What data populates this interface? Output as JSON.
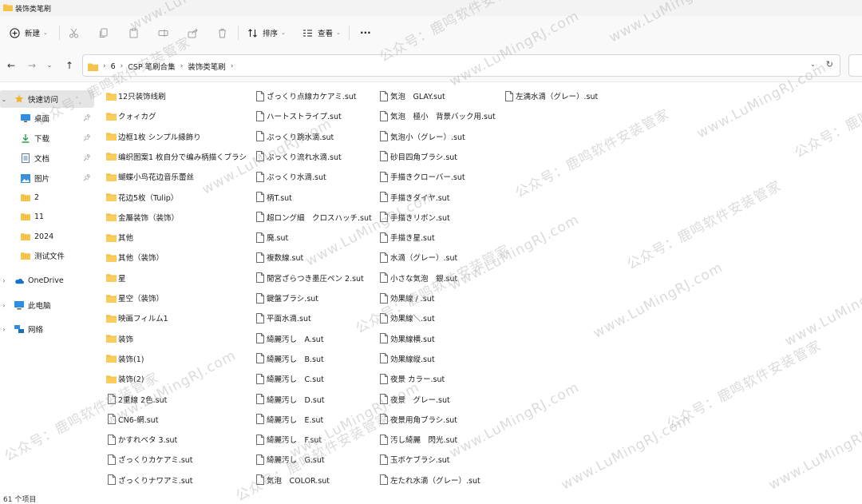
{
  "window": {
    "title": "装饰类笔刷"
  },
  "toolbar": {
    "new_label": "新建",
    "sort_label": "排序",
    "view_label": "查看",
    "more": "···"
  },
  "address": {
    "crumbs": [
      "6",
      "CSP 笔刷合集",
      "装饰类笔刷"
    ]
  },
  "sidebar": {
    "quick_access": "快速访问",
    "pinned": [
      "桌面",
      "下载",
      "文档",
      "图片"
    ],
    "folders": [
      "2",
      "11",
      "2024",
      "测试文件"
    ],
    "onedrive": "OneDrive",
    "this_pc": "此电脑",
    "network": "网络"
  },
  "files": {
    "col1": [
      {
        "name": "12只装饰线刷",
        "type": "folder"
      },
      {
        "name": "クォィカグ",
        "type": "folder"
      },
      {
        "name": "边框1枚 シンプル縁飾り",
        "type": "folder"
      },
      {
        "name": "编织图案1 枚自分で编み柄描くブラシ",
        "type": "folder"
      },
      {
        "name": "蝴蝶小鸟花边音乐蕾丝",
        "type": "folder"
      },
      {
        "name": "花边5枚（Tulip）",
        "type": "folder"
      },
      {
        "name": "金屬装饰（装饰）",
        "type": "folder"
      },
      {
        "name": "其他",
        "type": "folder"
      },
      {
        "name": "其他（装饰）",
        "type": "folder"
      },
      {
        "name": "星",
        "type": "folder"
      },
      {
        "name": "星空（装饰）",
        "type": "folder"
      },
      {
        "name": "映画フィルム1",
        "type": "folder"
      },
      {
        "name": "装饰",
        "type": "folder"
      },
      {
        "name": "装饰(1)",
        "type": "folder"
      },
      {
        "name": "装饰(2)",
        "type": "folder"
      },
      {
        "name": "2重線 2色.sut",
        "type": "file"
      },
      {
        "name": "CN6-網.sut",
        "type": "file"
      },
      {
        "name": "かすれベタ 3.sut",
        "type": "file"
      },
      {
        "name": "ざっくりカケアミ.sut",
        "type": "file"
      },
      {
        "name": "ざっくりナワアミ.sut",
        "type": "file"
      }
    ],
    "col2": [
      {
        "name": "ざっくり点線カケアミ.sut",
        "type": "file"
      },
      {
        "name": "ハートストライプ.sut",
        "type": "file"
      },
      {
        "name": "ぷっくり跳水滴.sut",
        "type": "file"
      },
      {
        "name": "ぷっくり流れ水滴.sut",
        "type": "file"
      },
      {
        "name": "ぷっくり水滴.sut",
        "type": "file"
      },
      {
        "name": "柄T.sut",
        "type": "file"
      },
      {
        "name": "超ロング細　クロスハッチ.sut",
        "type": "file"
      },
      {
        "name": "廃.sut",
        "type": "file"
      },
      {
        "name": "複数線.sut",
        "type": "file"
      },
      {
        "name": "閒宮ざらつき墨圧ペン 2.sut",
        "type": "file"
      },
      {
        "name": "鍵盤ブラシ.sut",
        "type": "file"
      },
      {
        "name": "平面水滴.sut",
        "type": "file"
      },
      {
        "name": "綺麗汚し　A.sut",
        "type": "file"
      },
      {
        "name": "綺麗汚し　B.sut",
        "type": "file"
      },
      {
        "name": "綺麗汚し　C.sut",
        "type": "file"
      },
      {
        "name": "綺麗汚し　D.sut",
        "type": "file"
      },
      {
        "name": "綺麗汚し　E.sut",
        "type": "file"
      },
      {
        "name": "綺麗汚し　F.sut",
        "type": "file"
      },
      {
        "name": "綺麗汚し　G.sut",
        "type": "file"
      },
      {
        "name": "気泡　COLOR.sut",
        "type": "file"
      }
    ],
    "col3": [
      {
        "name": "気泡　GLAY.sut",
        "type": "file"
      },
      {
        "name": "気泡　極小　背景バック用.sut",
        "type": "file"
      },
      {
        "name": "気泡小（グレー）.sut",
        "type": "file"
      },
      {
        "name": "砂目四角ブラシ.sut",
        "type": "file"
      },
      {
        "name": "手描きクローバー.sut",
        "type": "file"
      },
      {
        "name": "手描きダイヤ.sut",
        "type": "file"
      },
      {
        "name": "手描きリボン.sut",
        "type": "file"
      },
      {
        "name": "手描き星.sut",
        "type": "file"
      },
      {
        "name": "水滴（グレー）.sut",
        "type": "file"
      },
      {
        "name": "小さな気泡　銀.sut",
        "type": "file"
      },
      {
        "name": "効果線 / .sut",
        "type": "file"
      },
      {
        "name": "効果線＼.sut",
        "type": "file"
      },
      {
        "name": "効果線横.sut",
        "type": "file"
      },
      {
        "name": "効果線縦.sut",
        "type": "file"
      },
      {
        "name": "夜景 カラー.sut",
        "type": "file"
      },
      {
        "name": "夜景　グレー.sut",
        "type": "file"
      },
      {
        "name": "夜景用角ブラシ.sut",
        "type": "file"
      },
      {
        "name": "汚し綺麗　閃光.sut",
        "type": "file"
      },
      {
        "name": "玉ボケブラシ.sut",
        "type": "file"
      },
      {
        "name": "左たれ水滴（グレー）.sut",
        "type": "file"
      }
    ],
    "col4": [
      {
        "name": "左満水滴（グレー）.sut",
        "type": "file"
      }
    ]
  },
  "status": {
    "count": "61 个项目"
  },
  "watermark": {
    "a": "公众号：鹿鸣软件安装管家",
    "b": "www.LuMingRJ.com"
  },
  "colors": {
    "folder": "#f5c24a",
    "accent": "#0067c0",
    "selection": "#e5e5e5"
  }
}
